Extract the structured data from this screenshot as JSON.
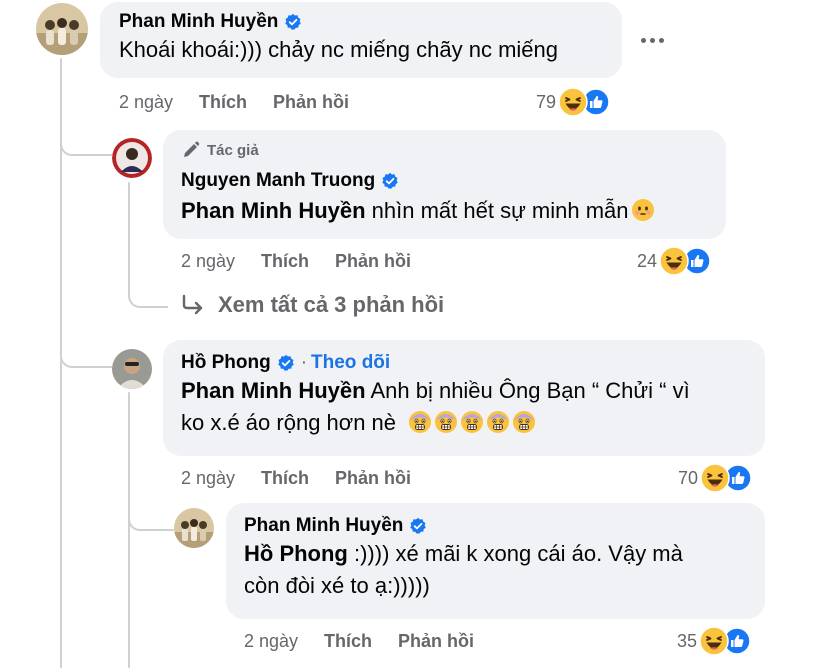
{
  "colors": {
    "bubble": "#f0f2f5",
    "meta_text": "#65676b",
    "link": "#1b74e4",
    "verified": "#1877f2"
  },
  "comments": [
    {
      "author": "Phan Minh Huyền",
      "verified": true,
      "text": "Khoái khoái:))) chảy nc miếng chãy nc miếng",
      "time": "2 ngày",
      "like_label": "Thích",
      "reply_label": "Phản hồi",
      "reaction_count": "79"
    },
    {
      "author_badge": "Tác giả",
      "author": "Nguyen Manh Truong",
      "verified": true,
      "mention": "Phan Minh Huyền",
      "text": " nhìn mất hết sự minh mẫn",
      "time": "2 ngày",
      "like_label": "Thích",
      "reply_label": "Phản hồi",
      "reaction_count": "24"
    },
    {
      "author": "Hồ Phong",
      "verified": true,
      "follow_label": "Theo dõi",
      "follow_sep": "·",
      "mention": "Phan Minh Huyền",
      "text_line1": " Anh bị nhiều Ông Bạn “ Chửi “ vì",
      "text_line2": "ko x.é áo rộng hơn nè",
      "time": "2 ngày",
      "like_label": "Thích",
      "reply_label": "Phản hồi",
      "reaction_count": "70"
    },
    {
      "author": "Phan Minh Huyền",
      "verified": true,
      "mention": "Hồ Phong",
      "text_line1": " :)))) xé mãi k xong cái áo. Vậy mà",
      "text_line2": "còn đòi xé to ạ:)))))",
      "time": "2 ngày",
      "like_label": "Thích",
      "reply_label": "Phản hồi",
      "reaction_count": "35"
    }
  ],
  "see_all_replies": "Xem tất cả 3 phản hồi",
  "icons": [
    "verified-badge-icon",
    "more-options-icon",
    "pencil-icon",
    "reply-arrow-icon",
    "laugh-emoji-icon",
    "like-icon",
    "blush-emoji-icon",
    "fearful-emoji-icon"
  ]
}
